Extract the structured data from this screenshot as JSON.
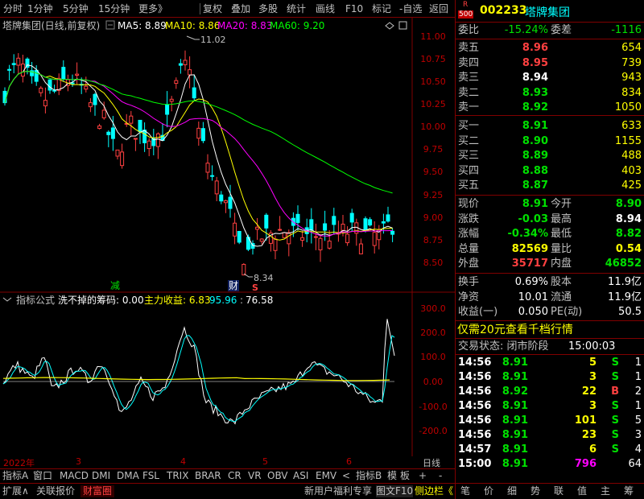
{
  "toolbar": {
    "items": [
      "分时",
      "1分钟",
      "5分钟",
      "15分钟",
      "更多》",
      "复权",
      "叠加",
      "多股",
      "统计",
      "画线",
      "F10",
      "标记",
      "-自选",
      "返回"
    ]
  },
  "chart_title": {
    "name": "塔牌集团(日线,前复权)",
    "ma5_label": "MA5: 8.89",
    "ma10_label": "MA10: 8.86",
    "ma20_label": "MA20: 8.83",
    "ma60_label": "MA60: 9.20"
  },
  "price_axis": [
    "11.00",
    "10.75",
    "10.50",
    "10.25",
    "10.00",
    "9.75",
    "9.50",
    "9.25",
    "9.00",
    "8.75",
    "8.50"
  ],
  "annotations": {
    "high": "11.02",
    "low": "8.34",
    "jian": "减",
    "cai": "财",
    "s": "S"
  },
  "indicator": {
    "title": "指标公式",
    "name": "洗不掉的筹码: 0.00",
    "main_label": "主力收益: 6.83",
    "v2": "95.96",
    "v3": "76.58",
    "axis": [
      "300.0",
      "200.0",
      "100.0",
      "0.00",
      "-100.0",
      "-200.0"
    ]
  },
  "date_axis": {
    "year": "2022年",
    "m3": "3",
    "m4": "4",
    "m5": "5",
    "m6": "6",
    "period": "日线"
  },
  "bottom_tabs": [
    "指标A",
    "窗口",
    "MACD",
    "DMI",
    "DMA",
    "FSL",
    "TRIX",
    "BRAR",
    "CR",
    "VR",
    "OBV",
    "ASI",
    "EMV",
    "<",
    "指标B",
    "模",
    "板",
    "+",
    "-"
  ],
  "bottom_bar2": {
    "expand": "扩展∧",
    "related": "关联报价",
    "wealth": "财富圈",
    "promo": "新用户福利专享",
    "f10": "图文F10",
    "sidebar": "侧边栏《"
  },
  "panel": {
    "badge_r": "R",
    "badge_num": "500",
    "code": "002233",
    "name": "塔牌集团",
    "weibi_label": "委比",
    "weibi": "-15.24%",
    "weicha_label": "委差",
    "weicha": "-1116",
    "asks": [
      {
        "label": "卖五",
        "price": "8.96",
        "vol": "654"
      },
      {
        "label": "卖四",
        "price": "8.95",
        "vol": "739"
      },
      {
        "label": "卖三",
        "price": "8.94",
        "vol": "943"
      },
      {
        "label": "卖二",
        "price": "8.93",
        "vol": "834"
      },
      {
        "label": "卖一",
        "price": "8.92",
        "vol": "1050"
      }
    ],
    "bids": [
      {
        "label": "买一",
        "price": "8.91",
        "vol": "633"
      },
      {
        "label": "买二",
        "price": "8.90",
        "vol": "1155"
      },
      {
        "label": "买三",
        "price": "8.89",
        "vol": "488"
      },
      {
        "label": "买四",
        "price": "8.88",
        "vol": "403"
      },
      {
        "label": "买五",
        "price": "8.87",
        "vol": "425"
      }
    ],
    "stats": [
      {
        "l1": "现价",
        "v1": "8.91",
        "l2": "今开",
        "v2": "8.90"
      },
      {
        "l1": "涨跌",
        "v1": "-0.03",
        "l2": "最高",
        "v2": "8.94"
      },
      {
        "l1": "涨幅",
        "v1": "-0.34%",
        "l2": "最低",
        "v2": "8.82"
      },
      {
        "l1": "总量",
        "v1": "82569",
        "l2": "量比",
        "v2": "0.54"
      },
      {
        "l1": "外盘",
        "v1": "35717",
        "l2": "内盘",
        "v2": "46852"
      }
    ],
    "stats2": [
      {
        "l1": "换手",
        "v1": "0.69%",
        "l2": "股本",
        "v2": "11.9亿"
      },
      {
        "l1": "净资",
        "v1": "10.01",
        "l2": "流通",
        "v2": "11.9亿"
      },
      {
        "l1": "收益(一)",
        "v1": "0.050",
        "l2": "PE(动)",
        "v2": "50.5"
      }
    ],
    "promo": "仅需20元查看千档行情",
    "trade_status": "交易状态: 闭市阶段",
    "trade_time": "15:00:03",
    "ticks": [
      {
        "time": "14:56",
        "price": "8.91",
        "vol": "5",
        "side": "S",
        "n": "1"
      },
      {
        "time": "14:56",
        "price": "8.91",
        "vol": "3",
        "side": "S",
        "n": "1"
      },
      {
        "time": "14:56",
        "price": "8.92",
        "vol": "22",
        "side": "B",
        "n": "2"
      },
      {
        "time": "14:56",
        "price": "8.91",
        "vol": "3",
        "side": "S",
        "n": "1"
      },
      {
        "time": "14:56",
        "price": "8.91",
        "vol": "101",
        "side": "S",
        "n": "5"
      },
      {
        "time": "14:56",
        "price": "8.91",
        "vol": "23",
        "side": "S",
        "n": "3"
      },
      {
        "time": "14:57",
        "price": "8.91",
        "vol": "6",
        "side": "S",
        "n": "4"
      },
      {
        "time": "15:00",
        "price": "8.91",
        "vol": "796",
        "side": "",
        "n": "64"
      }
    ],
    "bottom_icons": [
      "笔",
      "价",
      "细",
      "势",
      "联",
      "值",
      "主",
      "筹"
    ]
  },
  "colors": {
    "up": "#ff4040",
    "down": "#00ffff",
    "ma5": "#ffffff",
    "ma10": "#ffff00",
    "ma20": "#ff00ff",
    "ma60": "#00ff00",
    "frame": "#800000"
  }
}
